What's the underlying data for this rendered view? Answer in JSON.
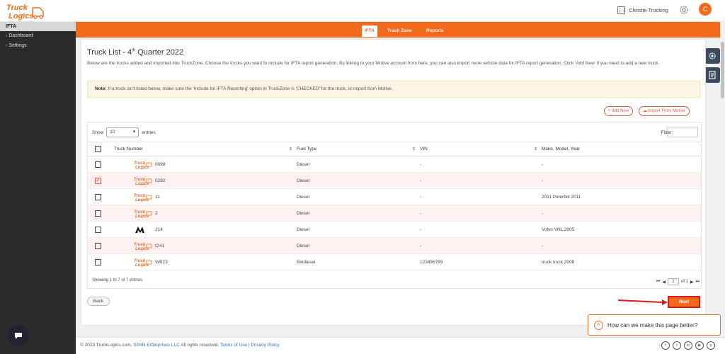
{
  "brand": {
    "logo_line1": "Truck",
    "logo_line2": "Logics",
    "accent": "#f26b1d"
  },
  "header": {
    "company": "Christie Trucking",
    "avatar_letter": "C"
  },
  "sidebar": {
    "section": "IFTA",
    "items": [
      {
        "label": "Dashboard"
      },
      {
        "label": "Settings"
      }
    ]
  },
  "tabs": [
    {
      "label": "IFTA",
      "active": true
    },
    {
      "label": "Truck Zone"
    },
    {
      "label": "Reports"
    }
  ],
  "page": {
    "title_prefix": "Truck List - 4",
    "title_sup": "th",
    "title_suffix": " Quarter 2022",
    "description": "Below are the trucks added and imported into TruckZone. Choose the trucks you want to include for IFTA report generation. By linking to your Motive account from here, you can also import more vehicle data for IFTA report generation. Click 'Add New' if you need to add a new truck",
    "note_label": "Note:",
    "note_text": " If a truck isn't listed below, make sure the 'Include for IFTA Reporting' option in TruckZone is 'CHECKED' for the truck, or import from Motive.",
    "add_new": "Add New",
    "import_motive": "Import From Motive"
  },
  "table": {
    "show_label": "Show",
    "entries_value": "10",
    "entries_label": "entries",
    "filter_label": "Filter:",
    "columns": [
      "Truck Number",
      "Fuel Type",
      "VIN",
      "Make, Model, Year"
    ],
    "rows": [
      {
        "checked": false,
        "logo": "trucklogics",
        "number": "0098",
        "fuel": "Diesel",
        "vin": "-",
        "mmy": "-"
      },
      {
        "checked": true,
        "logo": "trucklogics",
        "number": "0292",
        "fuel": "Diesel",
        "vin": "-",
        "mmy": "-"
      },
      {
        "checked": false,
        "logo": "trucklogics",
        "number": "11",
        "fuel": "Diesel",
        "vin": "-",
        "mmy": "2011 Peterbilt 2011"
      },
      {
        "checked": false,
        "logo": "trucklogics",
        "number": "2",
        "fuel": "Diesel",
        "vin": "-",
        "mmy": "-"
      },
      {
        "checked": false,
        "logo": "motive",
        "number": "214",
        "fuel": "Diesel",
        "vin": "-",
        "mmy": "Volvo VNL 2005"
      },
      {
        "checked": false,
        "logo": "trucklogics",
        "number": "CH1",
        "fuel": "Diesel",
        "vin": "-",
        "mmy": "-"
      },
      {
        "checked": false,
        "logo": "trucklogics",
        "number": "WB23",
        "fuel": "Biodiesel",
        "vin": "123456789",
        "mmy": "truck truck 2008"
      }
    ],
    "showing_text": "Showing 1 to 7 of 7 entries",
    "page_value": "1",
    "page_of": "of 1"
  },
  "actions": {
    "back": "Back",
    "next": "Next"
  },
  "help": {
    "text": "How can we make this page better?"
  },
  "footer": {
    "copyright": "© 2023 TruckLogics.com, ",
    "company_link": "SPAN Enterprises LLC",
    "rights": " All rights reserved. ",
    "terms": "Terms of Use",
    "sep": " | ",
    "privacy": "Privacy Policy"
  }
}
